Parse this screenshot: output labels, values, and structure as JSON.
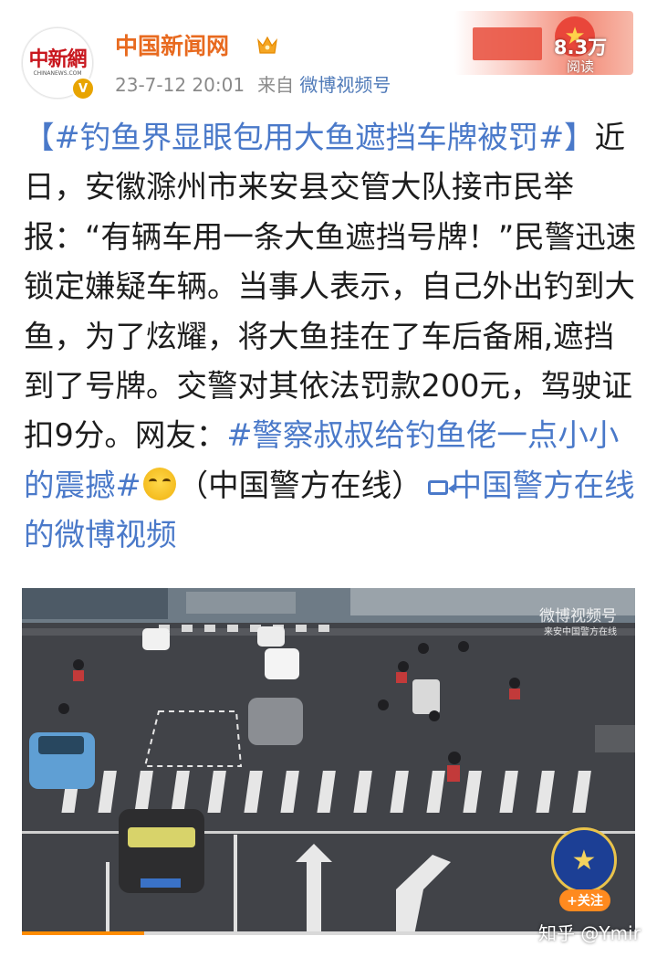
{
  "post": {
    "author": {
      "name": "中国新闻网",
      "avatar_logo_text": "中新網",
      "avatar_logo_sub": "CHINANEWS.COM",
      "verified_badge": "V"
    },
    "timestamp": "23-7-12 20:01",
    "source_prefix": "来自",
    "source": "微博视频号",
    "views": {
      "count": "8.3万",
      "label": "阅读"
    },
    "body": {
      "hashtag1": "【#钓鱼界显眼包用大鱼遮挡车牌被罚#】",
      "text1": "近日，安徽滁州市来安县交管大队接市民举报：“有辆车用一条大鱼遮挡号牌！”民警迅速锁定嫌疑车辆。当事人表示，自己外出钓到大鱼，为了炫耀，将大鱼挂在了车后备厢,遮挡到了号牌。交警对其依法罚款200元，驾驶证扣9分。网友：",
      "hashtag2": "#警察叔叔给钓鱼佬一点小小的震撼#",
      "text2": "（中国警方在线）",
      "video_link": "中国警方在线的微博视频"
    }
  },
  "video": {
    "brand": "微博视频号",
    "brand_sub": "来安中国警方在线",
    "follow_label": "+关注",
    "progress_fraction": 0.2
  },
  "watermark": {
    "site": "知乎",
    "separator": "@",
    "user": "Ymir"
  },
  "colors": {
    "username": "#e86a1f",
    "link_blue": "#4a79c9",
    "meta_gray": "#8a8a8a",
    "progress": "#ff8c00"
  },
  "icons": [
    "vip-crown-icon",
    "verified-icon",
    "laughing-crying-emoji-icon",
    "video-icon",
    "police-emblem-icon"
  ]
}
